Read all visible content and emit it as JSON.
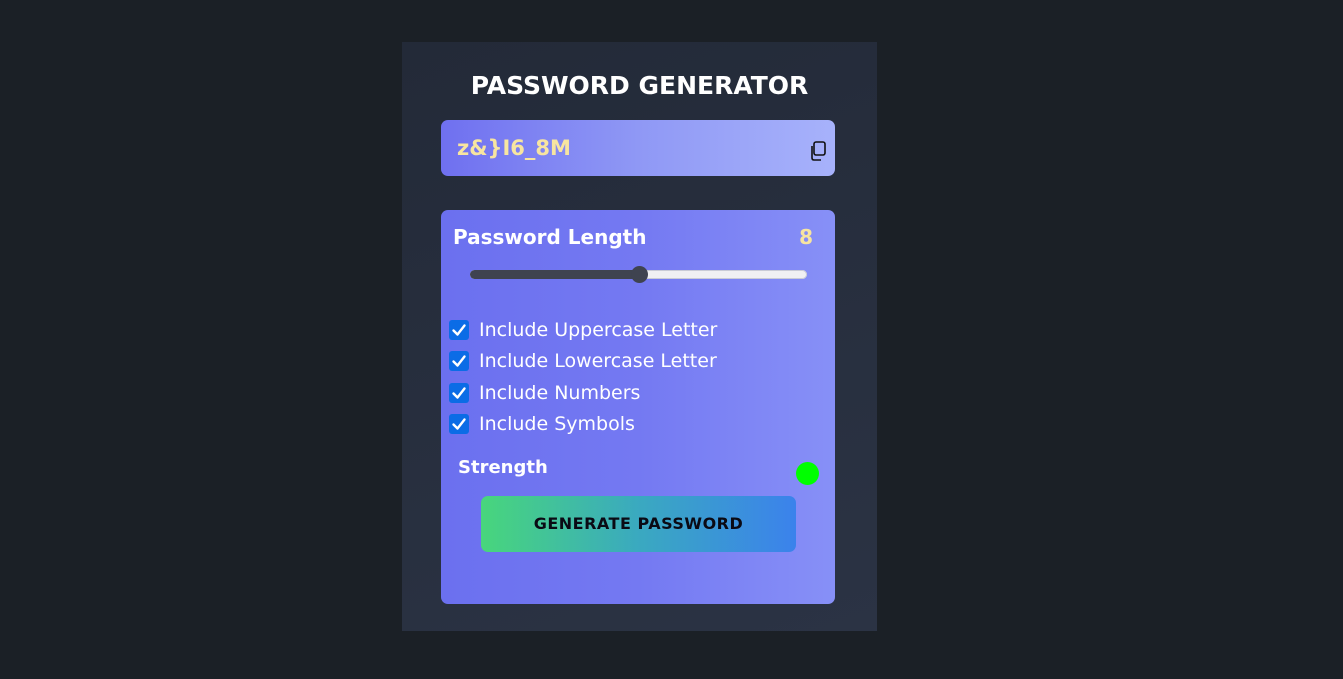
{
  "app": {
    "title": "PASSWORD GENERATOR"
  },
  "display": {
    "password": "z&}I6_8M",
    "copy_icon": "copy-icon"
  },
  "length": {
    "label": "Password Length",
    "value": "8",
    "slider_fraction": 0.5
  },
  "options": [
    {
      "label": "Include Uppercase Letter",
      "checked": true
    },
    {
      "label": "Include Lowercase Letter",
      "checked": true
    },
    {
      "label": "Include Numbers",
      "checked": true
    },
    {
      "label": "Include Symbols",
      "checked": true
    }
  ],
  "strength": {
    "label": "Strength",
    "indicator_color": "#00ff00"
  },
  "generate_button": {
    "label": "GENERATE PASSWORD"
  },
  "colors": {
    "background": "#1b2026",
    "accent_text": "#f7e5a0",
    "checkbox": "#0b6ce6"
  }
}
